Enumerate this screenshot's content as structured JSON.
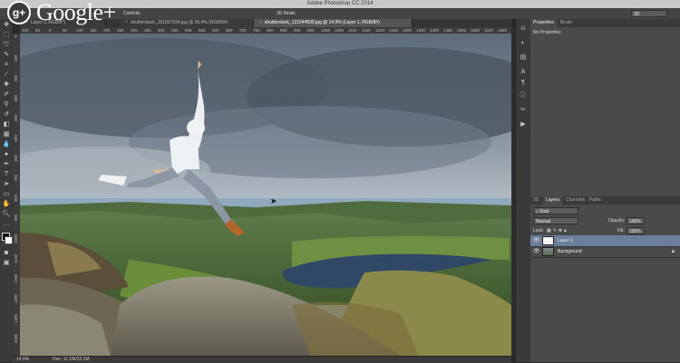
{
  "titlebar": {
    "title": "Adobe Photoshop CC 2014"
  },
  "watermark": {
    "logo_text": "g+",
    "wordmark": "Google+"
  },
  "options_bar": {
    "label1": "Controls",
    "label2": "3D Mode:",
    "workspace": "3D"
  },
  "doc_tabs": [
    {
      "label": "Layer 1, RGB/8*)",
      "active": false
    },
    {
      "label": "shutterstock_161827934.jpg @ 25.4% (RGB/8#)",
      "active": false
    },
    {
      "label": "shutterstock_121544599.jpg @ 14.9% (Layer 1, RGB/8#)",
      "active": true
    }
  ],
  "ruler_top_ticks": [
    "100",
    "50",
    "0",
    "50",
    "100",
    "150",
    "200",
    "250",
    "300",
    "350",
    "400",
    "450",
    "500",
    "550",
    "600",
    "650",
    "700",
    "750",
    "800",
    "850",
    "900",
    "950",
    "1000",
    "1050",
    "1100",
    "1150",
    "1200",
    "1250",
    "1300",
    "1350",
    "1400",
    "1450",
    "1500",
    "1550",
    "1600",
    "1650",
    "1700"
  ],
  "ruler_left_ticks": [
    "0",
    "100",
    "200",
    "300",
    "400",
    "500",
    "600",
    "700",
    "800",
    "900",
    "1000",
    "1100",
    "1200",
    "1300",
    "1400",
    "1500"
  ],
  "status": {
    "zoom": "14.9%",
    "doc": "Doc: 11.1M/22.1M"
  },
  "properties_panel": {
    "tabs": [
      "Properties",
      "Brush"
    ],
    "body": "No Properties"
  },
  "layers_panel": {
    "tabs": [
      "3D",
      "Layers",
      "Channels",
      "Paths"
    ],
    "kind": "Kind",
    "blend_mode": "Normal",
    "opacity_label": "Opacity:",
    "opacity": "100%",
    "lock_label": "Lock:",
    "fill_label": "Fill:",
    "fill": "100%",
    "layers": [
      {
        "name": "Layer 1",
        "selected": true
      },
      {
        "name": "Background",
        "selected": false
      }
    ]
  },
  "colors": {
    "ui_bg": "#2a2a2a",
    "panel": "#4a4a4a",
    "selection": "#6b7f9b",
    "sky": "#7a8896",
    "lake": "#2f4866"
  }
}
